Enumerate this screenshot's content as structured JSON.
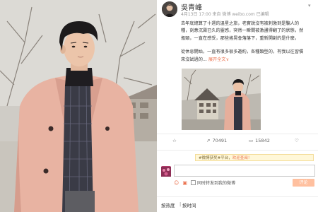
{
  "post": {
    "username": "吳青峰",
    "meta": "4月13日 17:00 来自 微博 weibo.com  已编辑",
    "paragraph1": [
      "去年底總算了十週的溫星之旅，老實說沒有被刺激到是騙人的",
      "種，刻意沉澱已久的靈感，突然一瞬間被激盪得翻了的狀態，然",
      "瓶頸，一直在感受，那些搖晃會落落下，重新開創的是什麼。"
    ],
    "paragraph2": [
      "從休息開始，一直有很多很多邀約，各種類型的，有我以往習慣",
      "來沒試過的"
    ],
    "expand_label": "展开全文",
    "expand_icon": "chevron-down",
    "actions": [
      {
        "icon": "share-icon",
        "label": ""
      },
      {
        "icon": "forward-icon",
        "label": "70491"
      },
      {
        "icon": "comment-icon",
        "label": "15842"
      },
      {
        "icon": "like-icon",
        "label": ""
      }
    ],
    "banner": {
      "prefix": "#微博获奖#平台，",
      "link": "欢迎查阅！"
    },
    "comment": {
      "placeholder": "",
      "emoji_icon": "emoji-icon",
      "image_icon": "image-icon",
      "checkbox_label": "同时转发到我的微博",
      "submit_label": "评论"
    },
    "tabs": [
      "按热度",
      "按时间"
    ]
  }
}
